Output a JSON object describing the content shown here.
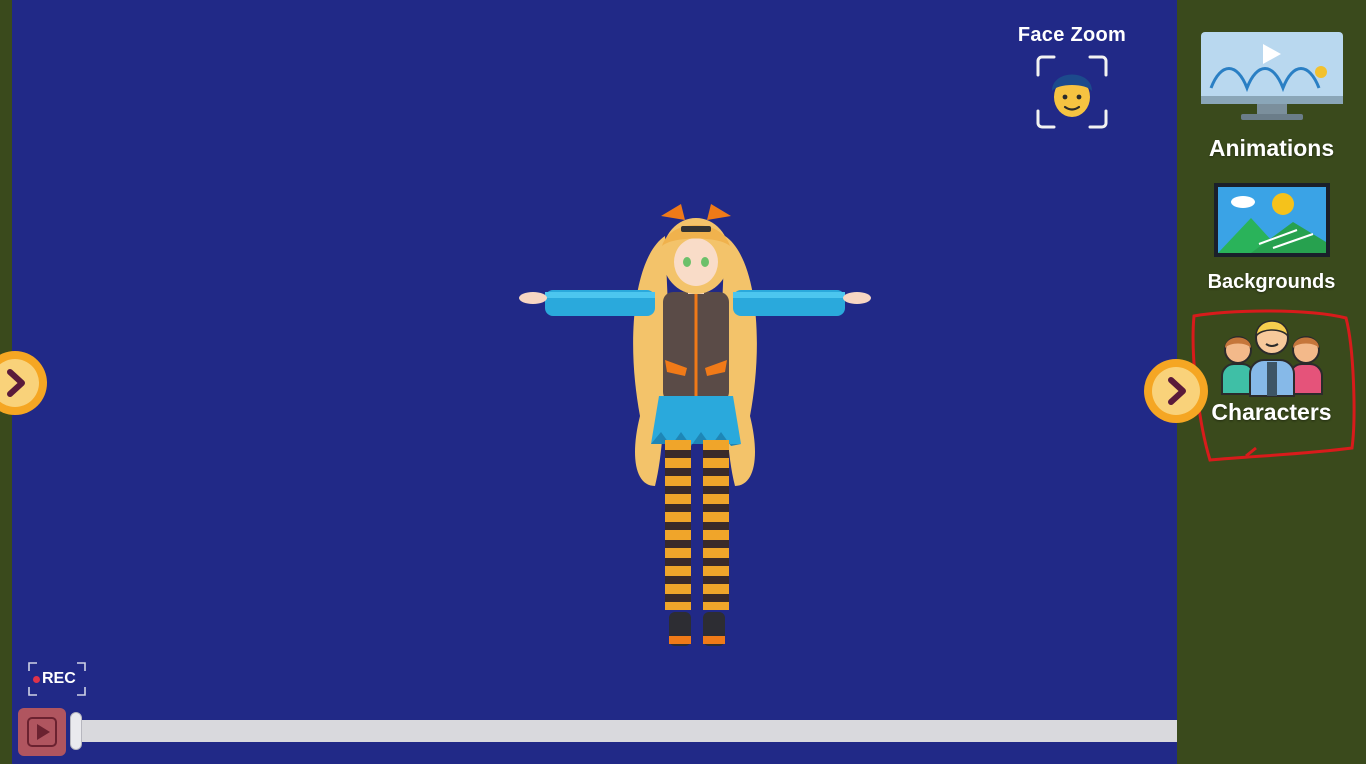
{
  "face_zoom": {
    "label": "Face Zoom",
    "icon": "face-zoom-icon"
  },
  "sidebar": {
    "items": [
      {
        "label": "Animations",
        "icon": "animations-icon"
      },
      {
        "label": "Backgrounds",
        "icon": "backgrounds-icon"
      },
      {
        "label": "Characters",
        "icon": "characters-icon",
        "highlighted": true
      }
    ]
  },
  "recorder": {
    "label": "REC"
  },
  "playback": {
    "progress": 0.0
  },
  "colors": {
    "stage": "#212987",
    "sidebar": "#3a4a1c",
    "highlight": "#d81b1b",
    "arrow_outer": "#f5a623",
    "arrow_chevron": "#5a1a3a"
  }
}
